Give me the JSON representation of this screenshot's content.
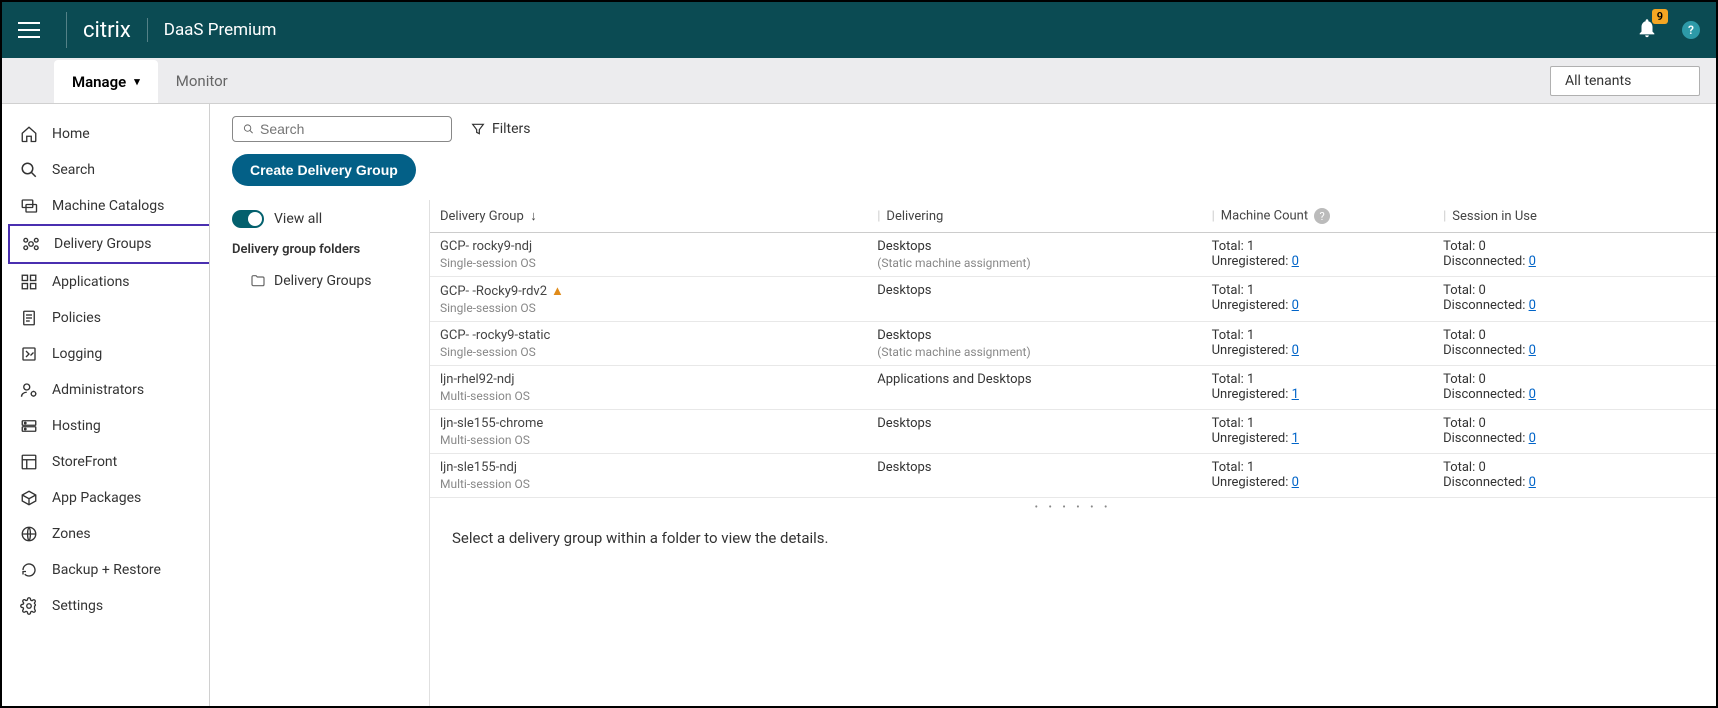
{
  "header": {
    "brand": "citrix",
    "product": "DaaS Premium",
    "notification_count": "9"
  },
  "subnav": {
    "tabs": [
      "Manage",
      "Monitor"
    ],
    "tenant_label": "All tenants"
  },
  "sidebar": {
    "items": [
      {
        "label": "Home"
      },
      {
        "label": "Search"
      },
      {
        "label": "Machine Catalogs"
      },
      {
        "label": "Delivery Groups"
      },
      {
        "label": "Applications"
      },
      {
        "label": "Policies"
      },
      {
        "label": "Logging"
      },
      {
        "label": "Administrators"
      },
      {
        "label": "Hosting"
      },
      {
        "label": "StoreFront"
      },
      {
        "label": "App Packages"
      },
      {
        "label": "Zones"
      },
      {
        "label": "Backup + Restore"
      },
      {
        "label": "Settings"
      }
    ]
  },
  "search": {
    "placeholder": "Search"
  },
  "filters_label": "Filters",
  "create_button": "Create Delivery Group",
  "folders": {
    "view_all": "View all",
    "header": "Delivery group folders",
    "root": "Delivery Groups"
  },
  "table": {
    "columns": {
      "dg": "Delivery Group",
      "delivering": "Delivering",
      "machine_count": "Machine Count",
      "session": "Session in Use"
    },
    "labels": {
      "total": "Total:",
      "unregistered": "Unregistered:",
      "disconnected": "Disconnected:"
    },
    "rows": [
      {
        "name": "GCP-       rocky9-ndj",
        "sub": "Single-session OS",
        "warn": false,
        "delivering": "Desktops",
        "delivering_sub": "(Static machine assignment)",
        "m_total": "1",
        "m_unreg": "0",
        "s_total": "0",
        "s_disc": "0"
      },
      {
        "name": "GCP-       -Rocky9-rdv2",
        "sub": "Single-session OS",
        "warn": true,
        "delivering": "Desktops",
        "delivering_sub": "",
        "m_total": "1",
        "m_unreg": "0",
        "s_total": "0",
        "s_disc": "0"
      },
      {
        "name": "GCP-       -rocky9-static",
        "sub": "Single-session OS",
        "warn": false,
        "delivering": "Desktops",
        "delivering_sub": "(Static machine assignment)",
        "m_total": "1",
        "m_unreg": "0",
        "s_total": "0",
        "s_disc": "0"
      },
      {
        "name": "ljn-rhel92-ndj",
        "sub": "Multi-session OS",
        "warn": false,
        "delivering": "Applications and Desktops",
        "delivering_sub": "",
        "m_total": "1",
        "m_unreg": "1",
        "s_total": "0",
        "s_disc": "0"
      },
      {
        "name": "ljn-sle155-chrome",
        "sub": "Multi-session OS",
        "warn": false,
        "delivering": "Desktops",
        "delivering_sub": "",
        "m_total": "1",
        "m_unreg": "1",
        "s_total": "0",
        "s_disc": "0"
      },
      {
        "name": "ljn-sle155-ndj",
        "sub": "Multi-session OS",
        "warn": false,
        "delivering": "Desktops",
        "delivering_sub": "",
        "m_total": "1",
        "m_unreg": "0",
        "s_total": "0",
        "s_disc": "0"
      }
    ]
  },
  "detail_hint": "Select a delivery group within a folder to view the details."
}
